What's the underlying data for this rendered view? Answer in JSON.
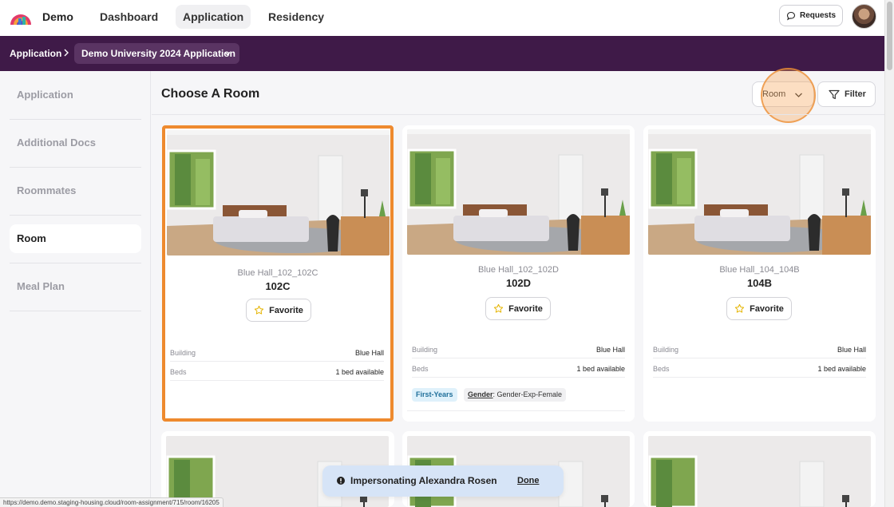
{
  "topnav": {
    "brand": "Demo",
    "links": [
      {
        "label": "Dashboard"
      },
      {
        "label": "Application",
        "active": true
      },
      {
        "label": "Residency"
      }
    ],
    "requests_label": "Requests"
  },
  "breadcrumb": {
    "home": "Application",
    "current": "Demo University 2024 Application"
  },
  "sidebar": {
    "items": [
      {
        "label": "Application"
      },
      {
        "label": "Additional Docs"
      },
      {
        "label": "Roommates"
      },
      {
        "label": "Room",
        "active": true
      },
      {
        "label": "Meal Plan"
      }
    ]
  },
  "main": {
    "title": "Choose A Room",
    "room_dropdown": "Room",
    "filter_label": "Filter"
  },
  "cards": [
    {
      "subtitle": "Blue Hall_102_102C",
      "code": "102C",
      "favorite_label": "Favorite",
      "building_label": "Building",
      "building_value": "Blue Hall",
      "beds_label": "Beds",
      "beds_value": "1 bed available",
      "selected": true
    },
    {
      "subtitle": "Blue Hall_102_102D",
      "code": "102D",
      "favorite_label": "Favorite",
      "building_label": "Building",
      "building_value": "Blue Hall",
      "beds_label": "Beds",
      "beds_value": "1 bed available",
      "tags": {
        "class": "First-Years",
        "gender_key": "Gender",
        "gender_value": ": Gender-Exp-Female"
      }
    },
    {
      "subtitle": "Blue Hall_104_104B",
      "code": "104B",
      "favorite_label": "Favorite",
      "building_label": "Building",
      "building_value": "Blue Hall",
      "beds_label": "Beds",
      "beds_value": "1 bed available"
    }
  ],
  "toast": {
    "text": "Impersonating Alexandra Rosen",
    "action": "Done"
  },
  "status_url": "https://demo.demo.staging-housing.cloud/room-assignment/715/room/16205",
  "colors": {
    "purple_bar": "#3f1a48",
    "selected_border": "#ee8a2e",
    "toast_bg": "#d6e4f7"
  }
}
